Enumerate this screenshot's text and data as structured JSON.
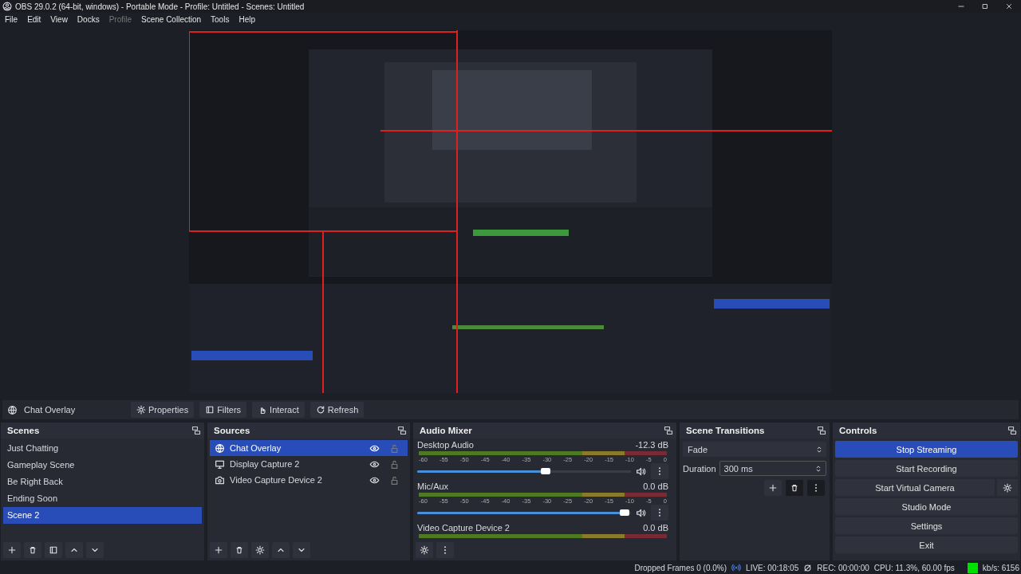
{
  "window": {
    "title": "OBS 29.0.2 (64-bit, windows) - Portable Mode - Profile: Untitled - Scenes: Untitled"
  },
  "menu": [
    {
      "label": "File",
      "disabled": false
    },
    {
      "label": "Edit",
      "disabled": false
    },
    {
      "label": "View",
      "disabled": false
    },
    {
      "label": "Docks",
      "disabled": false
    },
    {
      "label": "Profile",
      "disabled": true
    },
    {
      "label": "Scene Collection",
      "disabled": false
    },
    {
      "label": "Tools",
      "disabled": false
    },
    {
      "label": "Help",
      "disabled": false
    }
  ],
  "context_bar": {
    "source": "Chat Overlay",
    "buttons": [
      {
        "label": "Properties",
        "kind": "properties"
      },
      {
        "label": "Filters",
        "kind": "filters"
      },
      {
        "label": "Interact",
        "kind": "interact"
      },
      {
        "label": "Refresh",
        "kind": "refresh"
      }
    ]
  },
  "scenes": {
    "title": "Scenes",
    "items": [
      {
        "label": "Just Chatting",
        "selected": false
      },
      {
        "label": "Gameplay Scene",
        "selected": false
      },
      {
        "label": "Be Right Back",
        "selected": false
      },
      {
        "label": "Ending Soon",
        "selected": false
      },
      {
        "label": "Scene 2",
        "selected": true
      }
    ]
  },
  "sources": {
    "title": "Sources",
    "items": [
      {
        "label": "Chat Overlay",
        "kind": "browser",
        "selected": true,
        "visible": true,
        "locked": false
      },
      {
        "label": "Display Capture 2",
        "kind": "display",
        "selected": false,
        "visible": true,
        "locked": false
      },
      {
        "label": "Video Capture Device 2",
        "kind": "camera",
        "selected": false,
        "visible": true,
        "locked": false
      }
    ]
  },
  "audio_mixer": {
    "title": "Audio Mixer",
    "channels": [
      {
        "name": "Desktop Audio",
        "reading": "-12.3 dB",
        "level": 0.6,
        "ticks": [
          "-60",
          "-55",
          "-50",
          "-45",
          "-40",
          "-35",
          "-30",
          "-25",
          "-20",
          "-15",
          "-10",
          "-5",
          "0"
        ]
      },
      {
        "name": "Mic/Aux",
        "reading": "0.0 dB",
        "level": 0.97,
        "ticks": [
          "-60",
          "-55",
          "-50",
          "-45",
          "-40",
          "-35",
          "-30",
          "-25",
          "-20",
          "-15",
          "-10",
          "-5",
          "0"
        ]
      },
      {
        "name": "Video Capture Device 2",
        "reading": "0.0 dB"
      }
    ]
  },
  "scene_transitions": {
    "title": "Scene Transitions",
    "transition": "Fade",
    "duration_label": "Duration",
    "duration": "300 ms"
  },
  "controls": {
    "title": "Controls",
    "buttons": [
      {
        "label": "Stop Streaming",
        "active": true,
        "kind": "plain"
      },
      {
        "label": "Start Recording",
        "active": false,
        "kind": "plain"
      },
      {
        "label": "Start Virtual Camera",
        "active": false,
        "kind": "with-settings"
      },
      {
        "label": "Studio Mode",
        "active": false,
        "kind": "plain"
      },
      {
        "label": "Settings",
        "active": false,
        "kind": "plain"
      },
      {
        "label": "Exit",
        "active": false,
        "kind": "plain"
      }
    ]
  },
  "status_bar": {
    "dropped_frames": "Dropped Frames 0 (0.0%)",
    "live": "LIVE: 00:18:05",
    "rec": "REC: 00:00:00",
    "cpu": "CPU: 11.3%, 60.00 fps",
    "bitrate": "kb/s: 6156"
  }
}
